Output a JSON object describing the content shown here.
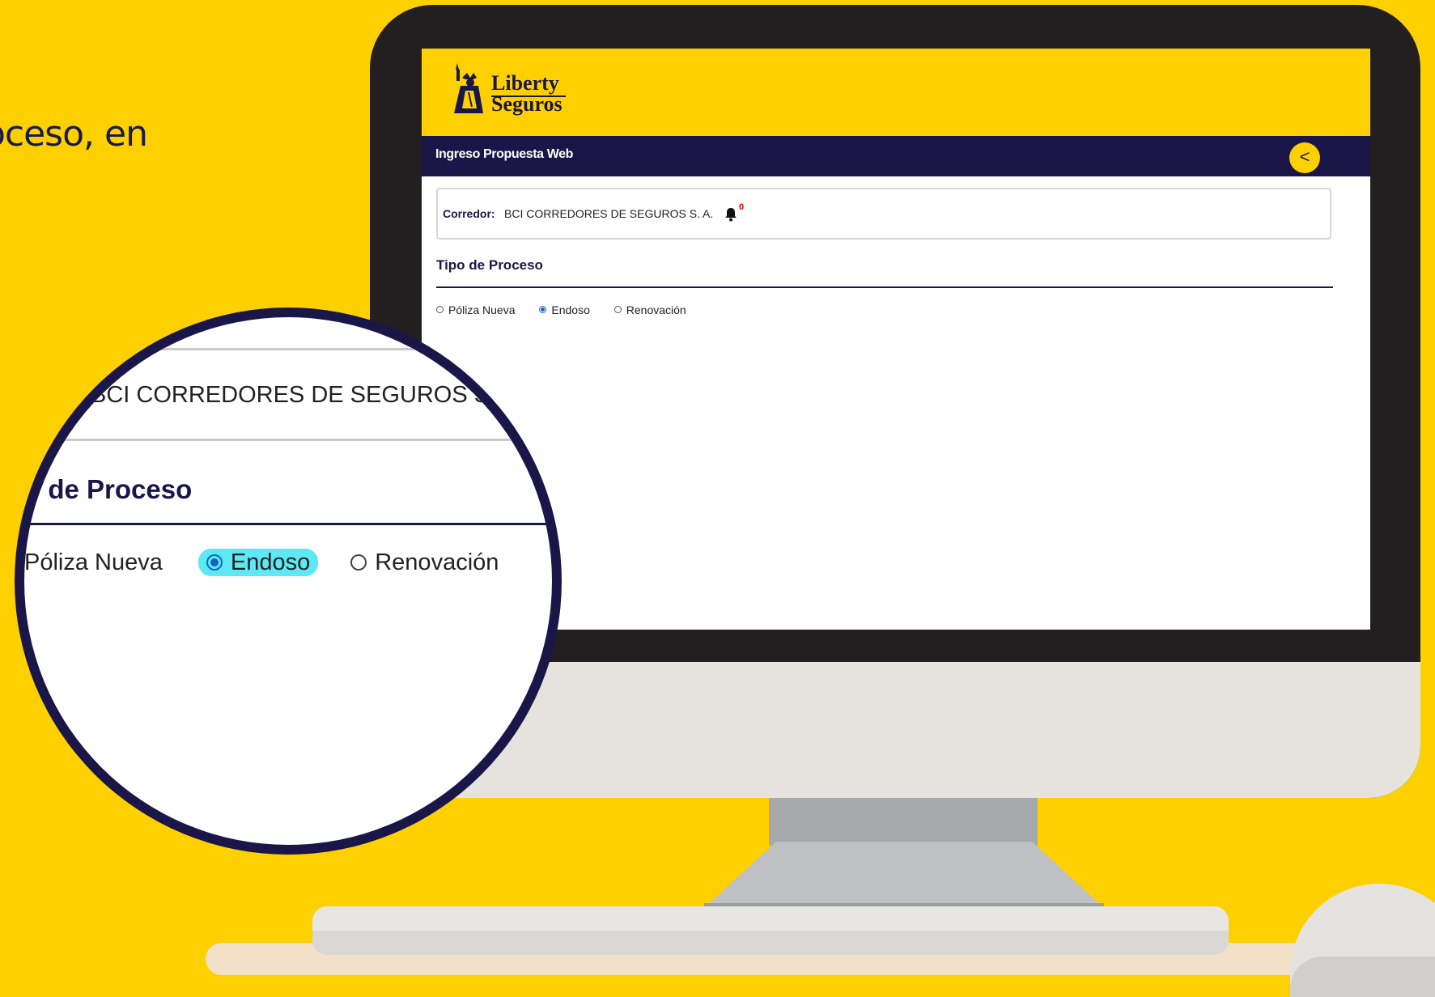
{
  "intro": {
    "text": "oceso, en"
  },
  "app": {
    "logo": {
      "line1": "Liberty",
      "line2": "Seguros"
    },
    "navbar": {
      "title": "Ingreso Propuesta Web",
      "back_icon": "<"
    },
    "broker": {
      "label": "Corredor:",
      "value": "BCI CORREDORES DE SEGUROS S. A.",
      "notification_count": "0"
    },
    "process": {
      "title": "Tipo de Proceso",
      "options": [
        {
          "label": "Póliza Nueva",
          "checked": false
        },
        {
          "label": "Endoso",
          "checked": true
        },
        {
          "label": "Renovación",
          "checked": false
        }
      ]
    }
  },
  "magnifier": {
    "broker_text": "BCI CORREDORES DE SEGUROS S",
    "title_text": "o de Proceso",
    "options": [
      "Póliza Nueva",
      "Endoso",
      "Renovación"
    ],
    "highlight_color": "#5CE8F5"
  },
  "colors": {
    "brand_yellow": "#FFD000",
    "brand_navy": "#1A1748"
  }
}
